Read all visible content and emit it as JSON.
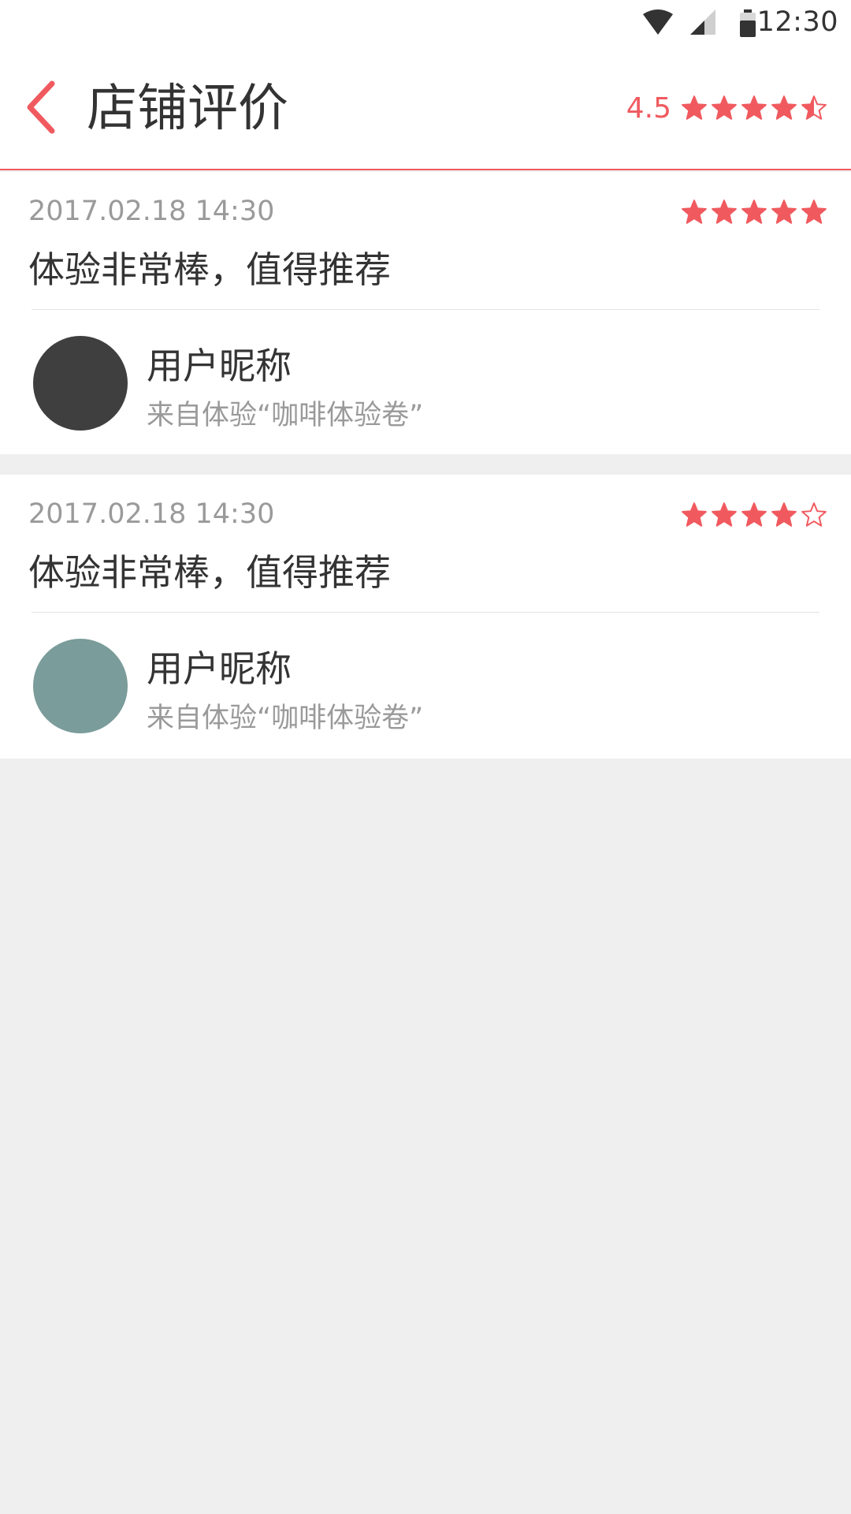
{
  "status_bar": {
    "time": "12:30",
    "icons": [
      "wifi-icon",
      "cell-signal-icon",
      "battery-icon"
    ]
  },
  "header": {
    "back_icon": "chevron-left-icon",
    "title": "店铺评价",
    "score": "4.5",
    "rating": 4.5,
    "rating_max": 5
  },
  "colors": {
    "accent": "#f05a5f",
    "avatar_1": "#3f3f3f",
    "avatar_2": "#7a9c9a"
  },
  "reviews": [
    {
      "time": "2017.02.18 14:30",
      "rating": 5,
      "content": "体验非常棒，值得推荐",
      "nickname": "用户昵称",
      "source": "来自体验“咖啡体验卷”",
      "avatar_color": "#3f3f3f"
    },
    {
      "time": "2017.02.18 14:30",
      "rating": 4,
      "content": "体验非常棒，值得推荐",
      "nickname": "用户昵称",
      "source": "来自体验“咖啡体验卷”",
      "avatar_color": "#7a9c9a"
    }
  ]
}
